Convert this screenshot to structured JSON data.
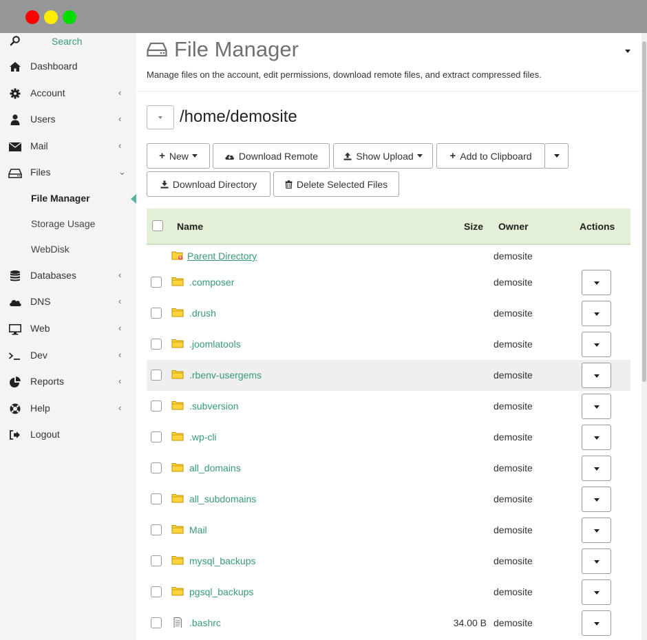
{
  "window": {
    "colors": {
      "close": "#ff0000",
      "minimize": "#ffee00",
      "maximize": "#00dd00",
      "accent": "#379a7a"
    }
  },
  "sidebar": {
    "search_label": "Search",
    "items": [
      {
        "label": "Dashboard",
        "icon": "home-icon",
        "chevron": ""
      },
      {
        "label": "Account",
        "icon": "gear-icon",
        "chevron": "‹"
      },
      {
        "label": "Users",
        "icon": "user-icon",
        "chevron": "‹"
      },
      {
        "label": "Mail",
        "icon": "envelope-icon",
        "chevron": "‹"
      },
      {
        "label": "Files",
        "icon": "hdd-icon",
        "chevron": "⌄"
      },
      {
        "label": "Databases",
        "icon": "database-icon",
        "chevron": "‹"
      },
      {
        "label": "DNS",
        "icon": "cloud-icon",
        "chevron": "‹"
      },
      {
        "label": "Web",
        "icon": "monitor-icon",
        "chevron": "‹"
      },
      {
        "label": "Dev",
        "icon": "terminal-icon",
        "chevron": "‹"
      },
      {
        "label": "Reports",
        "icon": "pie-chart-icon",
        "chevron": "‹"
      },
      {
        "label": "Help",
        "icon": "lifebuoy-icon",
        "chevron": "‹"
      },
      {
        "label": "Logout",
        "icon": "logout-icon",
        "chevron": ""
      }
    ],
    "files_subitems": [
      {
        "label": "File Manager",
        "active": true
      },
      {
        "label": "Storage Usage",
        "active": false
      },
      {
        "label": "WebDisk",
        "active": false
      }
    ]
  },
  "main": {
    "title": "File Manager",
    "description": "Manage files on the account, edit permissions, download remote files, and extract compressed files.",
    "current_path": "/home/demosite",
    "toolbar": {
      "new_label": "New",
      "download_remote_label": "Download Remote",
      "show_upload_label": "Show Upload",
      "add_clipboard_label": "Add to Clipboard",
      "download_directory_label": "Download Directory",
      "delete_selected_label": "Delete Selected Files"
    },
    "table": {
      "columns": {
        "name": "Name",
        "size": "Size",
        "owner": "Owner",
        "actions": "Actions"
      },
      "rows": [
        {
          "name": "Parent Directory",
          "size": "",
          "owner": "demosite",
          "type": "parent",
          "highlighted": false
        },
        {
          "name": ".composer",
          "size": "",
          "owner": "demosite",
          "type": "folder",
          "highlighted": false
        },
        {
          "name": ".drush",
          "size": "",
          "owner": "demosite",
          "type": "folder",
          "highlighted": false
        },
        {
          "name": ".joomlatools",
          "size": "",
          "owner": "demosite",
          "type": "folder",
          "highlighted": false
        },
        {
          "name": ".rbenv-usergems",
          "size": "",
          "owner": "demosite",
          "type": "folder",
          "highlighted": true
        },
        {
          "name": ".subversion",
          "size": "",
          "owner": "demosite",
          "type": "folder",
          "highlighted": false
        },
        {
          "name": ".wp-cli",
          "size": "",
          "owner": "demosite",
          "type": "folder",
          "highlighted": false
        },
        {
          "name": "all_domains",
          "size": "",
          "owner": "demosite",
          "type": "folder",
          "highlighted": false
        },
        {
          "name": "all_subdomains",
          "size": "",
          "owner": "demosite",
          "type": "folder",
          "highlighted": false
        },
        {
          "name": "Mail",
          "size": "",
          "owner": "demosite",
          "type": "folder",
          "highlighted": false
        },
        {
          "name": "mysql_backups",
          "size": "",
          "owner": "demosite",
          "type": "folder",
          "highlighted": false
        },
        {
          "name": "pgsql_backups",
          "size": "",
          "owner": "demosite",
          "type": "folder",
          "highlighted": false
        },
        {
          "name": ".bashrc",
          "size": "34.00 B",
          "owner": "demosite",
          "type": "file",
          "highlighted": false
        }
      ]
    }
  }
}
